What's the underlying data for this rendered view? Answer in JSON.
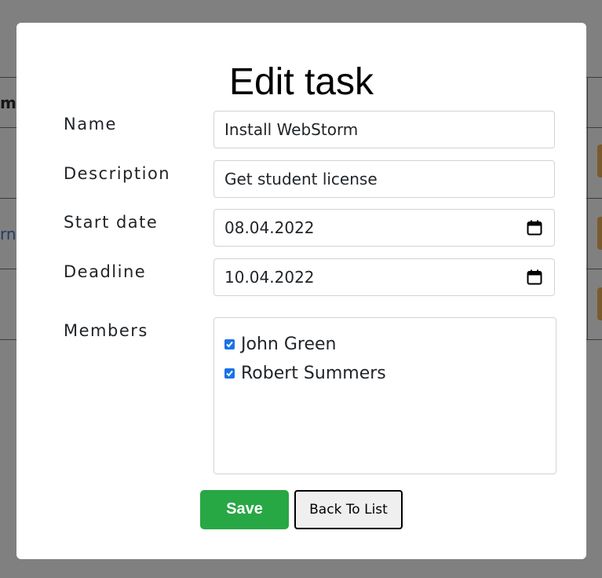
{
  "background": {
    "header_fragment": "m",
    "link_fragment": "rn"
  },
  "modal": {
    "title": "Edit task",
    "fields": {
      "name": {
        "label": "Name",
        "value": "Install WebStorm"
      },
      "description": {
        "label": "Description",
        "value": "Get student license"
      },
      "start_date": {
        "label": "Start date",
        "value": "08.04.2022",
        "icon": "calendar-icon"
      },
      "deadline": {
        "label": "Deadline",
        "value": "10.04.2022",
        "icon": "calendar-icon"
      },
      "members": {
        "label": "Members",
        "options": [
          {
            "name": "John Green",
            "checked": true
          },
          {
            "name": "Robert Summers",
            "checked": true
          }
        ]
      }
    },
    "buttons": {
      "save": "Save",
      "back": "Back To List"
    }
  },
  "colors": {
    "overlay": "#808080",
    "save_button": "#28a745",
    "checkbox": "#1a73e8",
    "input_border": "#ced4da"
  }
}
